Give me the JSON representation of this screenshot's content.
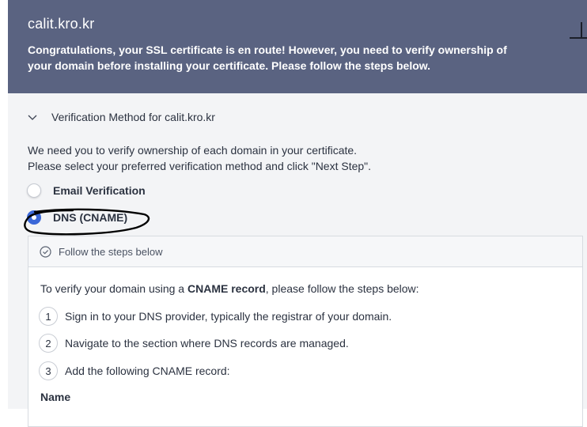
{
  "header": {
    "domain_title": "calit.kro.kr",
    "message": "Congratulations, your SSL certificate is en route! However, you need to verify ownership of your domain before installing your certificate. Please follow the steps below.",
    "bg_color": "#5a6381"
  },
  "section": {
    "title": "Verification Method for calit.kro.kr",
    "toggle_icon": "chevron-down-icon",
    "description_line1": "We need you to verify ownership of each domain in your certificate.",
    "description_line2": "Please select your preferred verification method and click \"Next Step\"."
  },
  "methods": [
    {
      "label": "Email Verification",
      "selected": false
    },
    {
      "label": "DNS (CNAME)",
      "selected": true
    }
  ],
  "steps_panel": {
    "header": "Follow the steps below",
    "header_icon": "check-circle-icon",
    "intro_prefix": "To verify your domain using a ",
    "intro_bold": "CNAME record",
    "intro_suffix": ", please follow the steps below:",
    "steps": [
      {
        "number": "1",
        "text": "Sign in to your DNS provider, typically the registrar of your domain."
      },
      {
        "number": "2",
        "text": "Navigate to the section where DNS records are managed."
      },
      {
        "number": "3",
        "text": "Add the following CNAME record:"
      }
    ],
    "name_label": "Name"
  },
  "colors": {
    "accent": "#3a67d8",
    "annotation": "#000000"
  }
}
